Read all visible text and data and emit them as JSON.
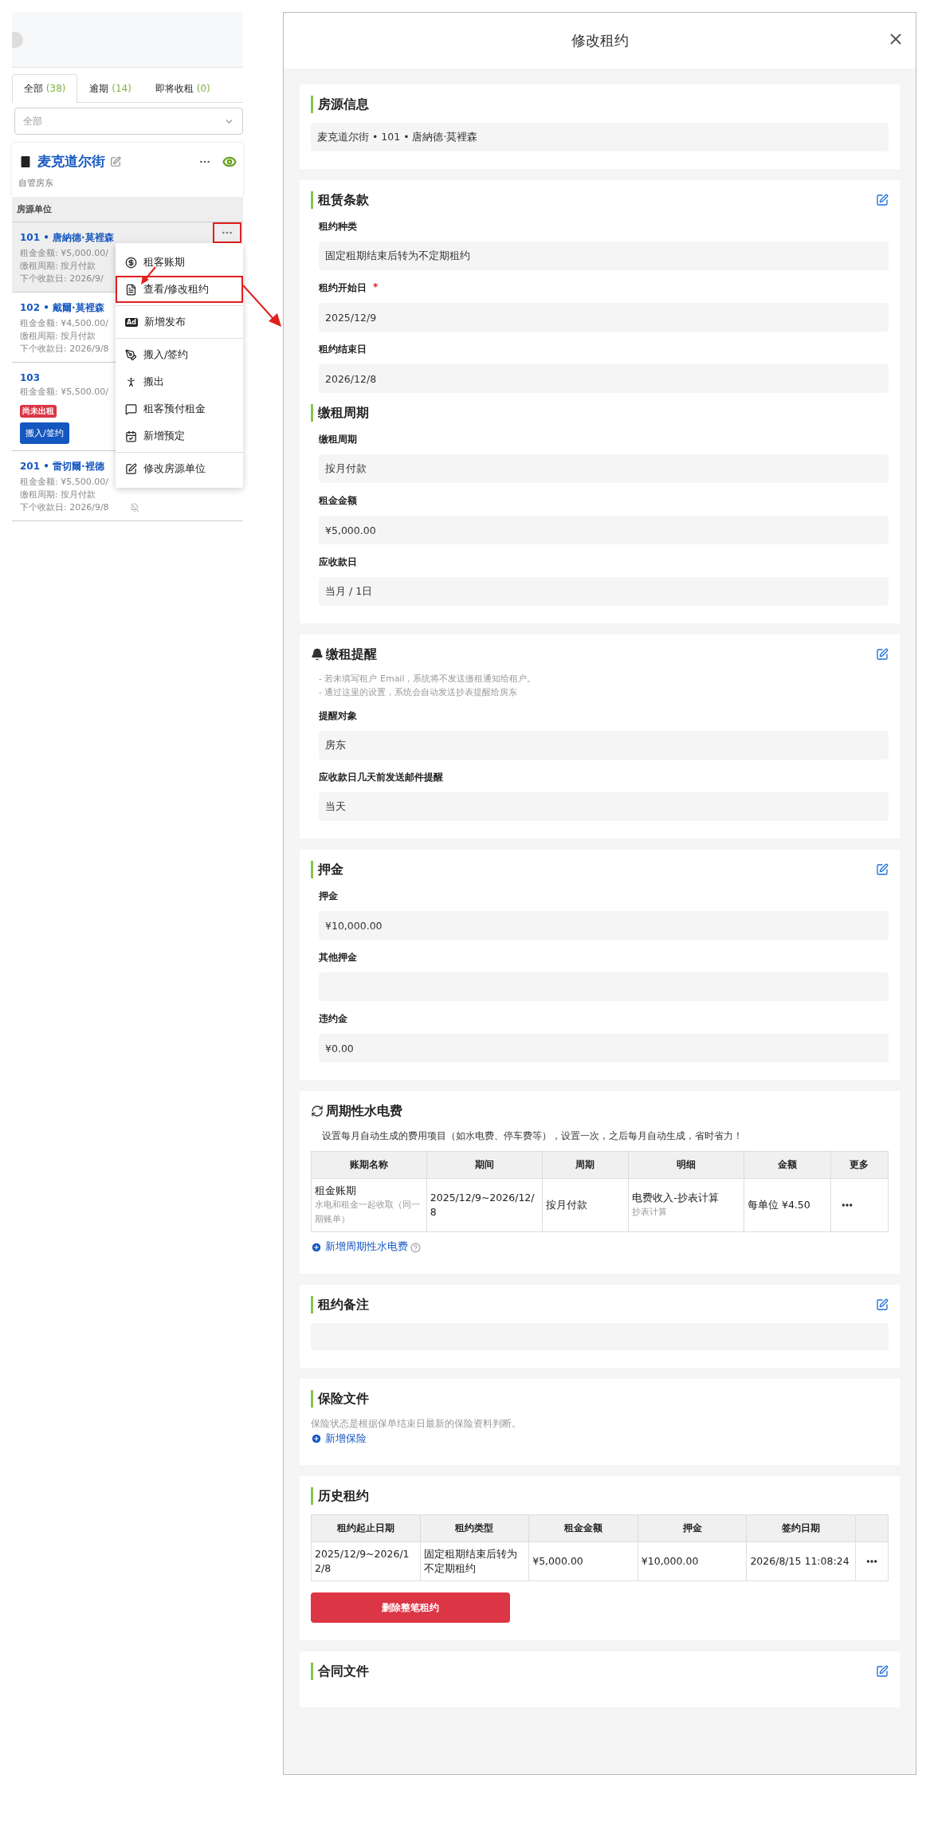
{
  "sidebar": {
    "tabs": [
      {
        "label": "全部",
        "count": "(38)",
        "selected": true
      },
      {
        "label": "逾期",
        "count": "(14)",
        "selected": false
      },
      {
        "label": "即将收租",
        "count": "(0)",
        "selected": false
      }
    ],
    "filter": {
      "placeholder": "全部"
    },
    "property": {
      "name": "麦克道尔街",
      "subtitle": "自管房东"
    },
    "units_header": "房源单位",
    "units": [
      {
        "name": "101 • 唐納德·莫裡森",
        "lines": [
          "租金金额: ¥5,000.00/",
          "缴租周期: 按月付款",
          "下个收款日: 2026/9/"
        ],
        "selected": true
      },
      {
        "name": "102 • 戴爾·莫裡森",
        "lines": [
          "租金金额: ¥4,500.00/",
          "缴租周期: 按月付款",
          "下个收款日: 2026/9/8"
        ],
        "selected": false
      },
      {
        "name": "103",
        "lines": [
          "租金金额: ¥5,500.00/"
        ],
        "badge": "尚未出租",
        "action": "搬入/签约",
        "selected": false
      },
      {
        "name": "201 • 雷切爾·裡德",
        "lines": [
          "租金金额: ¥5,500.00/",
          "缴租周期: 按月付款",
          "下个收款日: 2026/9/8"
        ],
        "selected": false,
        "bell_muted": true
      }
    ]
  },
  "context_menu": {
    "groups": [
      [
        {
          "label": "租客账期",
          "highlighted": false
        },
        {
          "label": "查看/修改租约",
          "highlighted": true
        }
      ],
      [
        {
          "label": "新增发布",
          "badge": "Ad",
          "highlighted": false
        }
      ],
      [
        {
          "label": "搬入/签约",
          "highlighted": false
        },
        {
          "label": "搬出",
          "highlighted": false
        },
        {
          "label": "租客预付租金",
          "highlighted": false
        },
        {
          "label": "新增预定",
          "highlighted": false
        }
      ],
      [
        {
          "label": "修改房源单位",
          "highlighted": false
        }
      ]
    ]
  },
  "modal": {
    "title": "修改租约",
    "sections": [
      {
        "kind": "plain",
        "title": "房源信息",
        "editable": false,
        "groups": [
          {
            "fields": [
              {
                "value": "麦克道尔街 • 101 • 唐納德·莫裡森"
              }
            ]
          }
        ]
      },
      {
        "kind": "plain",
        "title": "租赁条款",
        "editable": true,
        "groups": [
          {
            "fields": [
              {
                "label": "租约种类",
                "value": "固定租期结束后转为不定期租约"
              },
              {
                "label": "租约开始日",
                "value": "2025/12/9",
                "required_mark": "*"
              },
              {
                "label": "租约结束日",
                "value": "2026/12/8"
              }
            ]
          },
          {
            "subtitle": "缴租周期",
            "fields": [
              {
                "label": "缴租周期",
                "value": "按月付款"
              },
              {
                "label": "租金金额",
                "value": "¥5,000.00"
              },
              {
                "label": "应收款日",
                "value": "当月 / 1日"
              }
            ]
          }
        ]
      },
      {
        "kind": "reminder",
        "title": "缴租提醒",
        "editable": true,
        "notes": [
          "- 若未填写租户 Email，系统将不发送缴租通知给租户。",
          "- 通过这里的设置，系统会自动发送抄表提醒给房东"
        ],
        "groups": [
          {
            "fields": [
              {
                "label": "提醒对象",
                "value": "房东"
              },
              {
                "label": "应收款日几天前发送邮件提醒",
                "value": "当天"
              }
            ]
          }
        ]
      },
      {
        "kind": "plain",
        "title": "押金",
        "editable": true,
        "groups": [
          {
            "fields": [
              {
                "label": "押金",
                "value": "¥10,000.00"
              },
              {
                "label": "其他押金"
              },
              {
                "label": "违约金",
                "value": "¥0.00"
              }
            ]
          }
        ]
      },
      {
        "kind": "recurring",
        "title": "周期性水电费",
        "editable": false,
        "description": "设置每月自动生成的费用项目（如水电费、停车费等），设置一次，之后每月自动生成，省时省力！",
        "table": {
          "columns": [
            "账期名称",
            "期间",
            "周期",
            "明细",
            "金额",
            "更多"
          ],
          "rows": [
            {
              "cells": [
                {
                  "kind": "text",
                  "text": "租金账期",
                  "sub": "水电和租金一起收取（同一期账单）"
                },
                {
                  "kind": "text",
                  "text": "2025/12/9~2026/12/8"
                },
                {
                  "kind": "text",
                  "text": "按月付款"
                },
                {
                  "kind": "text",
                  "text": "电费收入-抄表计算",
                  "sub": "抄表计算"
                },
                {
                  "kind": "text",
                  "text": "每单位 ¥4.50"
                },
                {
                  "kind": "menu"
                }
              ]
            }
          ]
        },
        "add_link": "新增周期性水电费"
      },
      {
        "kind": "plain",
        "title": "租约备注",
        "editable": true,
        "empty_box": true
      },
      {
        "kind": "plain",
        "title": "保险文件",
        "editable": false,
        "description": "保险状态是根据保单结束日最新的保险资料判断。",
        "add_link": "新增保险"
      },
      {
        "kind": "plain",
        "title": "历史租约",
        "editable": false,
        "table": {
          "columns": [
            "租约起止日期",
            "租约类型",
            "租金金额",
            "押金",
            "签约日期"
          ],
          "rows": [
            {
              "cells": [
                {
                  "kind": "text",
                  "text": "2025/12/9~2026/12/8"
                },
                {
                  "kind": "text",
                  "text": "固定租期结束后转为不定期租约"
                },
                {
                  "kind": "text",
                  "text": "¥5,000.00"
                },
                {
                  "kind": "text",
                  "text": "¥10,000.00"
                },
                {
                  "kind": "text",
                  "text": "2026/8/15 11:08:24"
                },
                {
                  "kind": "menu"
                }
              ]
            }
          ]
        },
        "delete_button": "删除整笔租约"
      },
      {
        "kind": "plain",
        "title": "合同文件",
        "editable": true
      }
    ]
  }
}
